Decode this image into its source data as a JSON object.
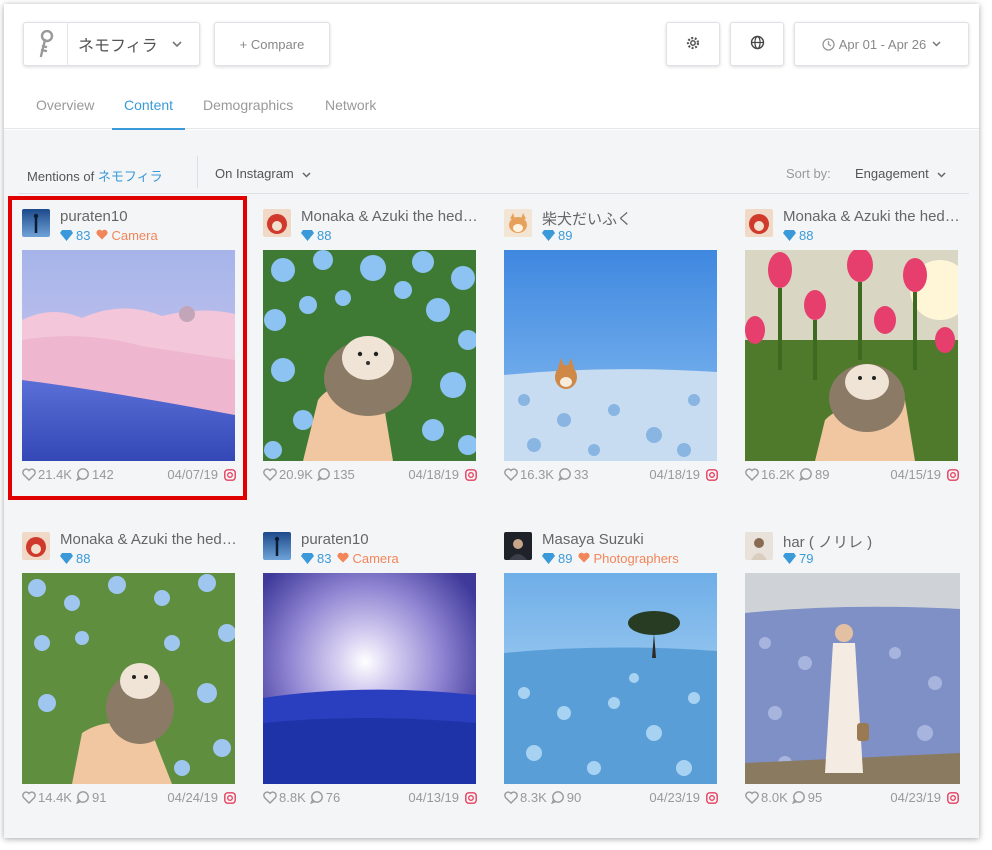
{
  "header": {
    "brand_name": "ネモフィラ",
    "compare_label": "+ Compare",
    "date_range": "Apr 01 - Apr 26",
    "icons": [
      "key-icon",
      "gear-icon",
      "globe-icon",
      "clock-icon"
    ]
  },
  "tabs": [
    {
      "label": "Overview",
      "active": false
    },
    {
      "label": "Content",
      "active": true
    },
    {
      "label": "Demographics",
      "active": false
    },
    {
      "label": "Network",
      "active": false
    }
  ],
  "filters": {
    "mentions_prefix": "Mentions of",
    "mentions_term": "ネモフィラ",
    "network": "On Instagram",
    "sort_label": "Sort by:",
    "sort_value": "Engagement"
  },
  "posts": [
    {
      "user": "puraten10",
      "score": "83",
      "category": "Camera",
      "likes": "21.4K",
      "comments": "142",
      "date": "04/07/19"
    },
    {
      "user": "Monaka & Azuki the hedgehogs",
      "score": "88",
      "category": "",
      "likes": "20.9K",
      "comments": "135",
      "date": "04/18/19"
    },
    {
      "user": "柴犬だいふく",
      "score": "89",
      "category": "",
      "likes": "16.3K",
      "comments": "33",
      "date": "04/18/19"
    },
    {
      "user": "Monaka & Azuki the hedgehogs",
      "score": "88",
      "category": "",
      "likes": "16.2K",
      "comments": "89",
      "date": "04/15/19"
    },
    {
      "user": "Monaka & Azuki the hedgehogs",
      "score": "88",
      "category": "",
      "likes": "14.4K",
      "comments": "91",
      "date": "04/24/19"
    },
    {
      "user": "puraten10",
      "score": "83",
      "category": "Camera",
      "likes": "8.8K",
      "comments": "76",
      "date": "04/13/19"
    },
    {
      "user": "Masaya Suzuki",
      "score": "89",
      "category": "Photographers",
      "likes": "8.3K",
      "comments": "90",
      "date": "04/23/19"
    },
    {
      "user": "har ( ノリレ )",
      "score": "79",
      "category": "",
      "likes": "8.0K",
      "comments": "95",
      "date": "04/23/19"
    }
  ],
  "colors": {
    "accent": "#3a9ad9",
    "category": "#f2865b",
    "instagram": "#e4405f",
    "highlight": "#e00000"
  }
}
